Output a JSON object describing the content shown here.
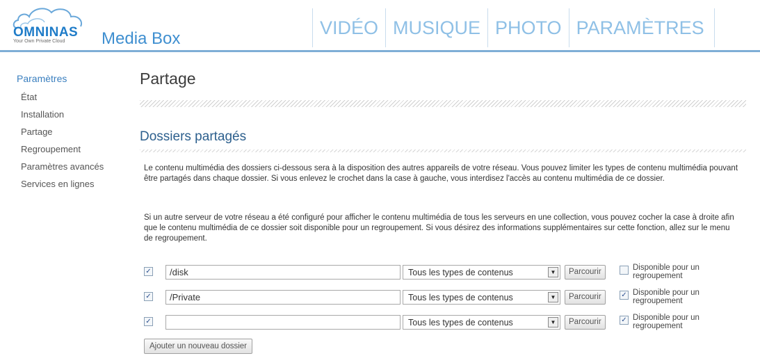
{
  "brand": {
    "logo_name": "OMNINAS",
    "tagline": "Your Own Private Cloud",
    "product": "Media Box",
    "colors": {
      "accent": "#1f7cc8",
      "nav": "#8fc0e6",
      "section": "#2c5f8d",
      "rule": "#7eaed6"
    }
  },
  "nav": {
    "items": [
      "VIDÉO",
      "MUSIQUE",
      "PHOTO",
      "PARAMÈTRES"
    ]
  },
  "sidebar": {
    "title": "Paramètres",
    "items": [
      "État",
      "Installation",
      "Partage",
      "Regroupement",
      "Paramètres avancés",
      "Services en lignes"
    ]
  },
  "main": {
    "title": "Partage",
    "section_title": "Dossiers partagés",
    "paragraph1": "Le contenu multimédia des dossiers ci-dessous sera à la disposition des autres appareils de votre réseau. Vous pouvez limiter les types de contenu multimédia pouvant être partagés dans chaque dossier. Si vous enlevez le crochet dans la case à gauche, vous interdisez l'accès au contenu multimédia de ce dossier.",
    "paragraph2": "Si un autre serveur de votre réseau a été configuré pour afficher le contenu multimédia de tous les serveurs en une collection, vous pouvez cocher la case à droite afin que le contenu multimédia de ce dossier soit disponible pour un regroupement. Si vous désirez des informations supplémentaires sur cette fonction, allez sur le menu de regroupement.",
    "folders": [
      {
        "enabled": true,
        "path": "/disk",
        "content_type": "Tous les types de contenus",
        "browse": "Parcourir",
        "grouping": false,
        "grouping_label": "Disponible pour un regroupement"
      },
      {
        "enabled": true,
        "path": "/Private",
        "content_type": "Tous les types de contenus",
        "browse": "Parcourir",
        "grouping": true,
        "grouping_label": "Disponible pour un regroupement"
      },
      {
        "enabled": true,
        "path": "",
        "content_type": "Tous les types de contenus",
        "browse": "Parcourir",
        "grouping": true,
        "grouping_label": "Disponible pour un regroupement"
      }
    ],
    "add_button": "Ajouter un nouveau dossier"
  }
}
